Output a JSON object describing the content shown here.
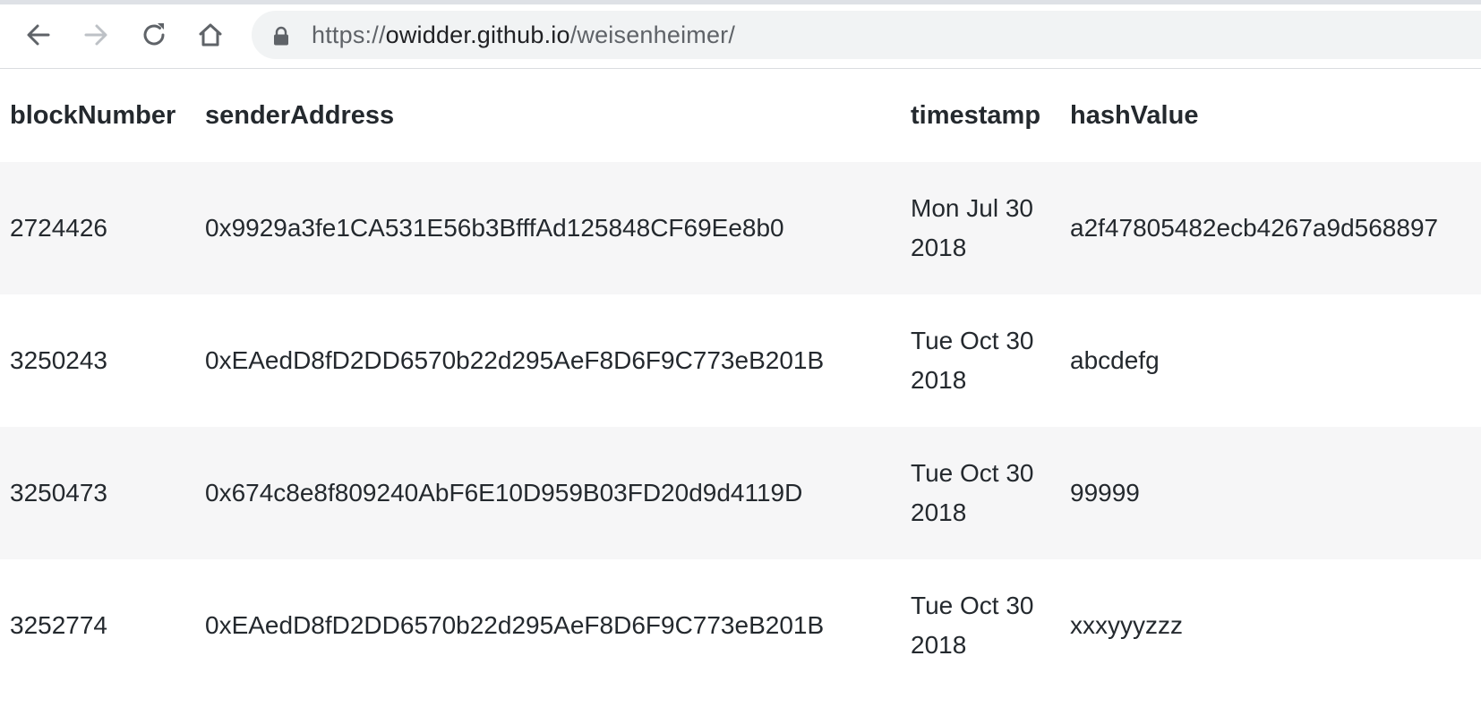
{
  "browser": {
    "url_scheme": "https://",
    "url_host": "owidder.github.io",
    "url_path": "/weisenheimer/"
  },
  "table": {
    "headers": [
      "blockNumber",
      "senderAddress",
      "timestamp",
      "hashValue"
    ],
    "rows": [
      {
        "blockNumber": "2724426",
        "senderAddress": "0x9929a3fe1CA531E56b3BfffAd125848CF69Ee8b0",
        "timestamp": "Mon Jul 30 2018",
        "hashValue": "a2f47805482ecb4267a9d568897"
      },
      {
        "blockNumber": "3250243",
        "senderAddress": "0xEAedD8fD2DD6570b22d295AeF8D6F9C773eB201B",
        "timestamp": "Tue Oct 30 2018",
        "hashValue": "abcdefg"
      },
      {
        "blockNumber": "3250473",
        "senderAddress": "0x674c8e8f809240AbF6E10D959B03FD20d9d4119D",
        "timestamp": "Tue Oct 30 2018",
        "hashValue": "99999"
      },
      {
        "blockNumber": "3252774",
        "senderAddress": "0xEAedD8fD2DD6570b22d295AeF8D6F9C773eB201B",
        "timestamp": "Tue Oct 30 2018",
        "hashValue": "xxxyyyzzz"
      }
    ]
  }
}
